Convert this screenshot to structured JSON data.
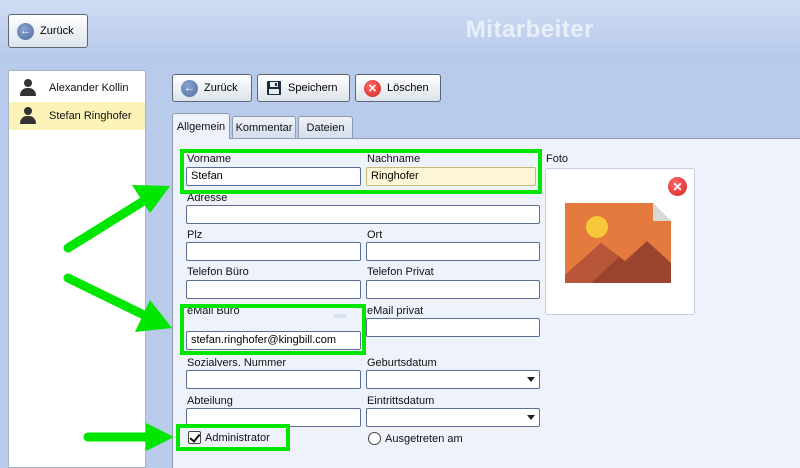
{
  "header": {
    "back_label": "Zurück",
    "title": "Mitarbeiter"
  },
  "employees": [
    {
      "name": "Alexander Kollin",
      "selected": false
    },
    {
      "name": "Stefan Ringhofer",
      "selected": true
    }
  ],
  "toolbar": {
    "back_label": "Zurück",
    "save_label": "Speichern",
    "delete_label": "Löschen"
  },
  "tabs": [
    {
      "label": "Allgemein",
      "active": true
    },
    {
      "label": "Kommentar",
      "active": false
    },
    {
      "label": "Dateien",
      "active": false
    }
  ],
  "form": {
    "vorname": {
      "label": "Vorname",
      "value": "Stefan"
    },
    "nachname": {
      "label": "Nachname",
      "value": "Ringhofer"
    },
    "adresse": {
      "label": "Adresse",
      "value": ""
    },
    "plz": {
      "label": "Plz",
      "value": ""
    },
    "ort": {
      "label": "Ort",
      "value": ""
    },
    "telefon_buero": {
      "label": "Telefon Büro",
      "value": ""
    },
    "telefon_privat": {
      "label": "Telefon Privat",
      "value": ""
    },
    "email_buero": {
      "label": "eMail Büro",
      "value": "stefan.ringhofer@kingbill.com"
    },
    "email_privat": {
      "label": "eMail privat",
      "value": ""
    },
    "sozialvers": {
      "label": "Sozialvers. Nummer",
      "value": ""
    },
    "geburtsdatum": {
      "label": "Geburtsdatum",
      "value": ""
    },
    "abteilung": {
      "label": "Abteilung",
      "value": ""
    },
    "eintrittsdatum": {
      "label": "Eintrittsdatum",
      "value": ""
    },
    "administrator": {
      "label": "Administrator",
      "checked": true
    },
    "ausgetreten": {
      "label": "Ausgetreten am",
      "checked": false
    }
  },
  "photo": {
    "label": "Foto"
  },
  "colors": {
    "highlight": "#00e600",
    "accent": "#4d6ca3",
    "delete": "#d42222",
    "selected_row": "#fbf3b7"
  },
  "icons": [
    "back-arrow-icon",
    "floppy-disk-icon",
    "delete-x-icon",
    "person-icon",
    "image-placeholder-icon",
    "checkmark-icon",
    "dropdown-arrow-icon"
  ]
}
